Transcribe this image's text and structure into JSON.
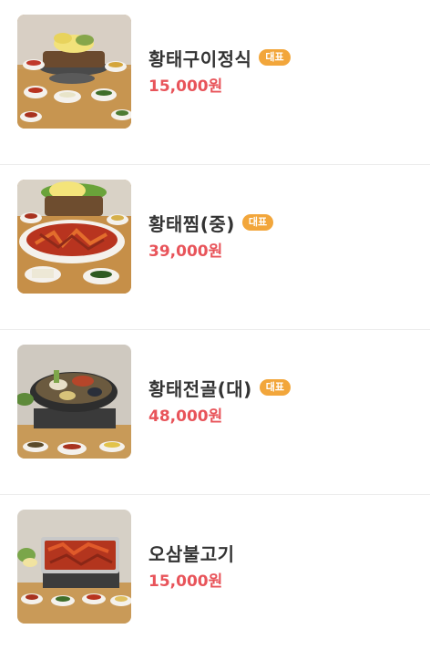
{
  "menu": {
    "items": [
      {
        "name": "황태구이정식",
        "badge": "대표",
        "price": "15,000원",
        "image": "grilled-pollack-set-photo"
      },
      {
        "name": "황태찜(중)",
        "badge": "대표",
        "price": "39,000원",
        "image": "braised-pollack-photo"
      },
      {
        "name": "황태전골(대)",
        "badge": "대표",
        "price": "48,000원",
        "image": "pollack-hotpot-photo"
      },
      {
        "name": "오삼불고기",
        "badge": "",
        "price": "15,000원",
        "image": "squid-pork-bulgogi-photo"
      }
    ]
  },
  "colors": {
    "price": "#e8545a",
    "badge": "#f2a63b",
    "divider": "#ececec",
    "title": "#333333"
  }
}
